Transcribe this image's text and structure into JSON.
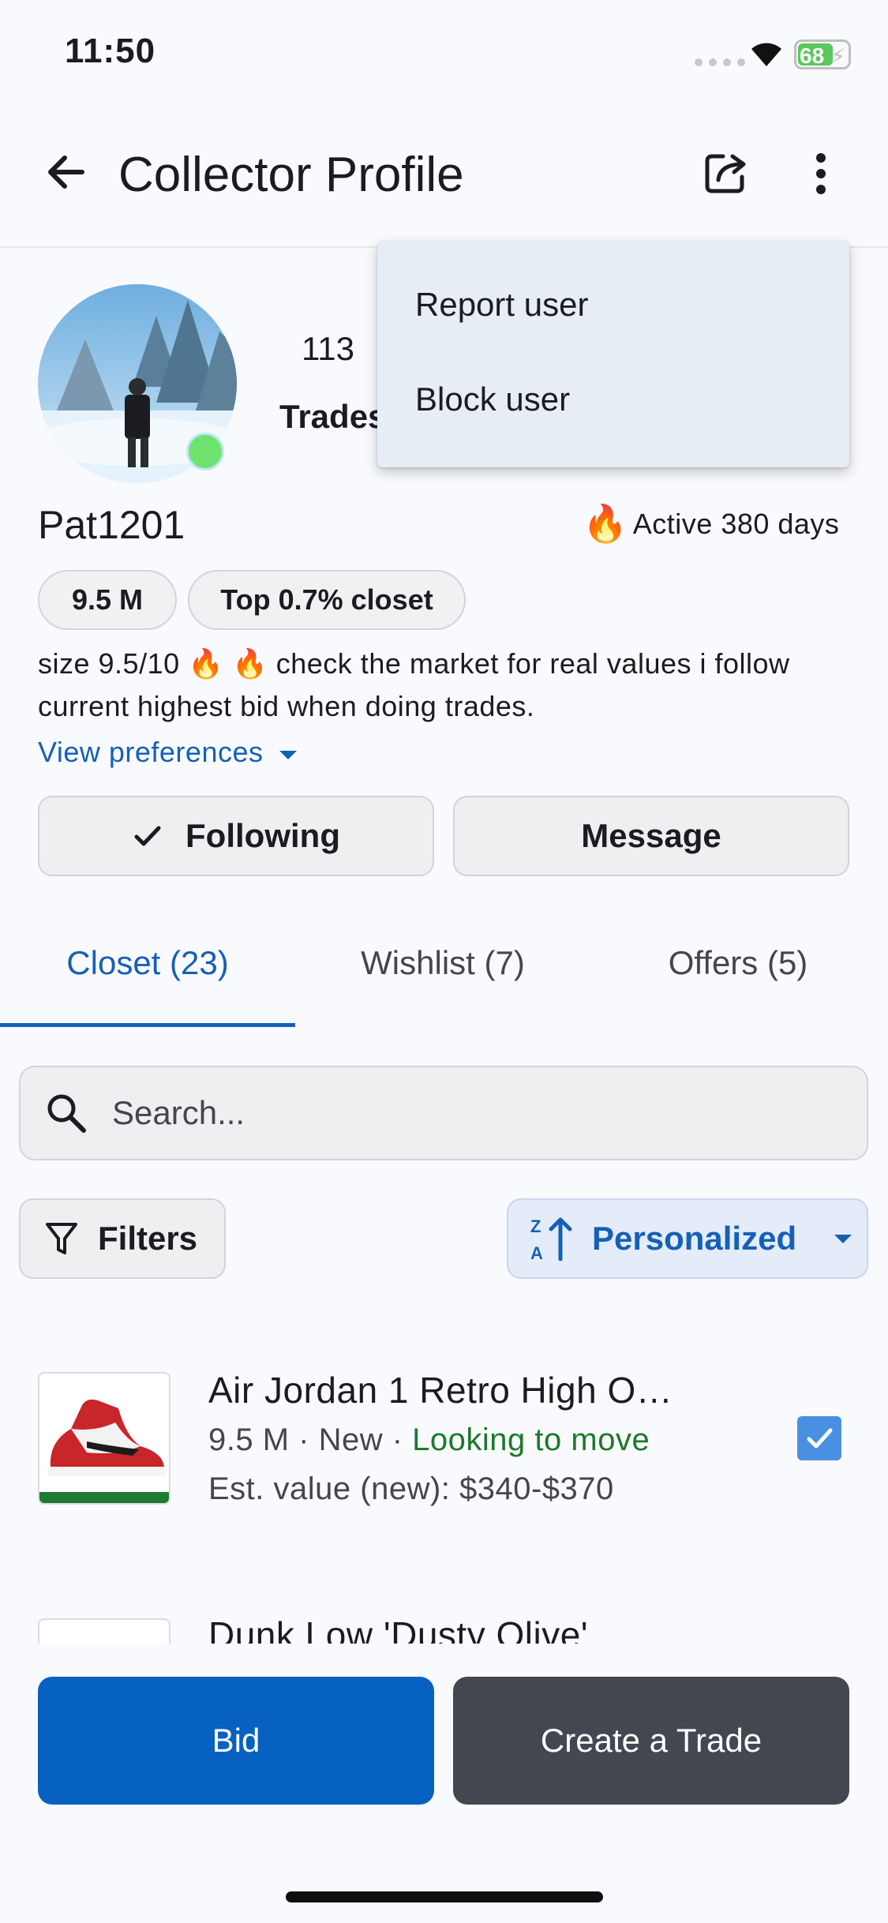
{
  "status_bar": {
    "time": "11:50",
    "battery": "68"
  },
  "header": {
    "title": "Collector Profile"
  },
  "profile": {
    "stat_count": "113",
    "stat_label": "Trades",
    "username": "Pat1201",
    "active_text": "Active 380 days",
    "chips": [
      "9.5 M",
      "Top 0.7% closet"
    ],
    "bio": "size 9.5/10 🔥 🔥 check the market for real values i follow current highest bid when doing trades.",
    "view_preferences": "View preferences",
    "following_label": "Following",
    "message_label": "Message"
  },
  "menu": {
    "items": [
      "Report user",
      "Block user"
    ]
  },
  "tabs": [
    {
      "label": "Closet (23)",
      "active": true
    },
    {
      "label": "Wishlist (7)",
      "active": false
    },
    {
      "label": "Offers (5)",
      "active": false
    }
  ],
  "search": {
    "placeholder": "Search..."
  },
  "filters_label": "Filters",
  "sort_label": "Personalized",
  "items": [
    {
      "title": "Air Jordan 1 Retro High O…",
      "meta_size": "9.5 M",
      "meta_condition": "New",
      "meta_status": "Looking to move",
      "value": "Est. value (new): $340-$370",
      "checked": true
    },
    {
      "title": "Dunk Low 'Dusty Olive'"
    }
  ],
  "buttons": {
    "bid": "Bid",
    "create_trade": "Create a Trade"
  },
  "colors": {
    "primary": "#0761c0",
    "accent_green": "#1a7a2a",
    "online": "#6ee36e"
  }
}
